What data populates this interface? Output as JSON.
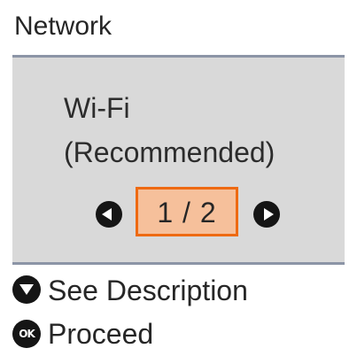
{
  "header": {
    "title": "Network"
  },
  "main": {
    "option_line1": "Wi-Fi",
    "option_line2": "(Recommended)",
    "page_indicator": "1 / 2"
  },
  "footer": {
    "description": {
      "icon": "down-icon",
      "label": "See Description"
    },
    "proceed": {
      "icon": "ok-icon",
      "icon_text": "OK",
      "label": "Proceed"
    }
  },
  "colors": {
    "panel_background": "#d9d9d9",
    "divider": "#8c95a6",
    "highlight_fill": "#f6c09b",
    "highlight_border": "#ee6a12",
    "icon": "#151515"
  },
  "icons": {
    "prev": "left-arrow-icon",
    "next": "right-arrow-icon"
  }
}
